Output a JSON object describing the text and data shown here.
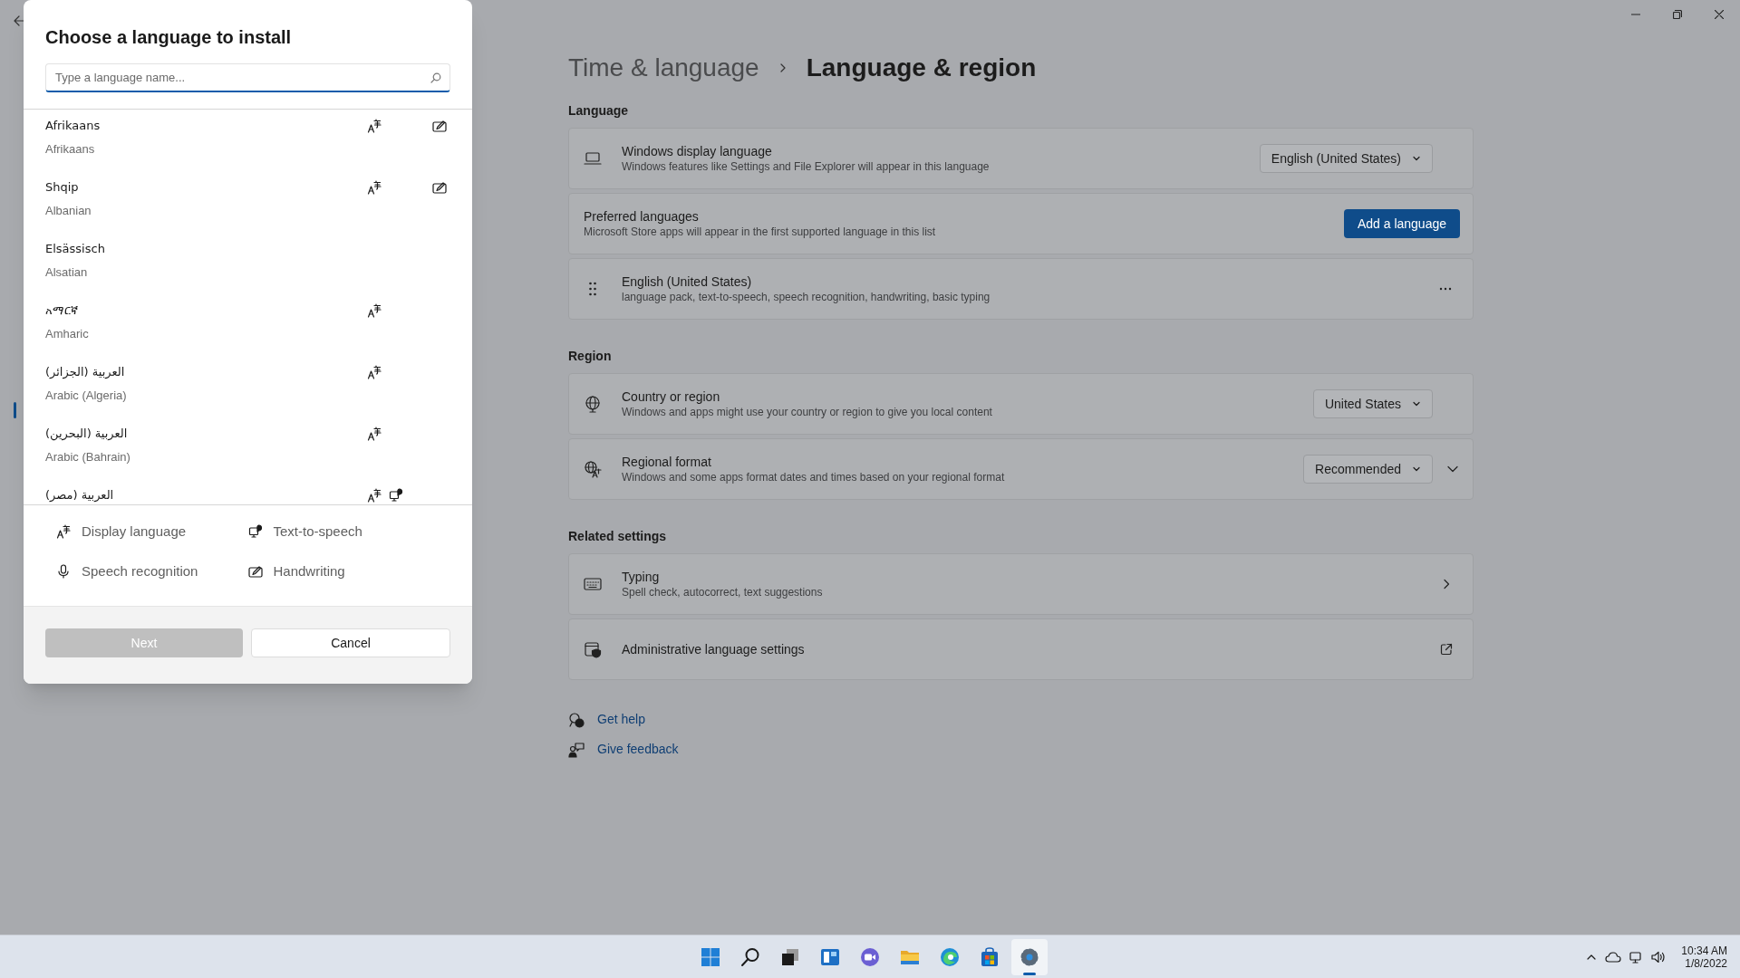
{
  "window": {
    "breadcrumb": [
      "Time & language",
      "Language & region"
    ]
  },
  "sections": [
    {
      "heading": "Language",
      "cards": [
        {
          "kind": "dropdown",
          "title": "Windows display language",
          "subtitle": "Windows features like Settings and File Explorer will appear in this language",
          "value": "English (United States)"
        },
        {
          "kind": "button",
          "title": "Preferred languages",
          "subtitle": "Microsoft Store apps will appear in the first supported language in this list",
          "button": "Add a language"
        },
        {
          "kind": "more",
          "title": "English (United States)",
          "subtitle": "language pack, text-to-speech, speech recognition, handwriting, basic typing"
        }
      ]
    },
    {
      "heading": "Region",
      "cards": [
        {
          "kind": "dropdown",
          "title": "Country or region",
          "subtitle": "Windows and apps might use your country or region to give you local content",
          "value": "United States"
        },
        {
          "kind": "dropdown_expand",
          "title": "Regional format",
          "subtitle": "Windows and some apps format dates and times based on your regional format",
          "value": "Recommended",
          "expanded": false
        }
      ]
    },
    {
      "heading": "Related settings",
      "cards": [
        {
          "kind": "link",
          "title": "Typing",
          "subtitle": "Spell check, autocorrect, text suggestions"
        },
        {
          "kind": "external",
          "title": "Administrative language settings"
        }
      ]
    }
  ],
  "links": [
    "Get help",
    "Give feedback"
  ],
  "dialog": {
    "title": "Choose a language to install",
    "search": {
      "placeholder": "Type a language name..."
    },
    "languages": [
      {
        "native": "Afrikaans",
        "english": "Afrikaans",
        "display_language": true,
        "text_to_speech": false,
        "speech_recognition": false,
        "handwriting": true
      },
      {
        "native": "Shqip",
        "english": "Albanian",
        "display_language": true,
        "text_to_speech": false,
        "speech_recognition": false,
        "handwriting": true
      },
      {
        "native": "Elsässisch",
        "english": "Alsatian",
        "display_language": false,
        "text_to_speech": false,
        "speech_recognition": false,
        "handwriting": false
      },
      {
        "native": "አማርኛ",
        "english": "Amharic",
        "display_language": true,
        "text_to_speech": false,
        "speech_recognition": false,
        "handwriting": false
      },
      {
        "native": "العربية (الجزائر)",
        "english": "Arabic (Algeria)",
        "display_language": true,
        "text_to_speech": false,
        "speech_recognition": false,
        "handwriting": false
      },
      {
        "native": "العربية (البحرين)",
        "english": "Arabic (Bahrain)",
        "display_language": true,
        "text_to_speech": false,
        "speech_recognition": false,
        "handwriting": false
      },
      {
        "native": "العربية (مصر)",
        "display_language": true,
        "text_to_speech": true,
        "speech_recognition": false,
        "handwriting": false
      }
    ],
    "legend": [
      {
        "kind": "display_language",
        "label": "Display language"
      },
      {
        "kind": "text_to_speech",
        "label": "Text-to-speech"
      },
      {
        "kind": "speech_recognition",
        "label": "Speech recognition"
      },
      {
        "kind": "handwriting",
        "label": "Handwriting"
      }
    ],
    "buttons": [
      {
        "label": "Next",
        "disabled": true
      },
      {
        "label": "Cancel",
        "disabled": false
      }
    ]
  },
  "taskbar": {
    "apps": [
      {
        "selected": false
      },
      {
        "selected": false
      },
      {
        "selected": false
      },
      {
        "selected": false
      },
      {
        "selected": false
      },
      {
        "selected": false
      },
      {
        "selected": false
      },
      {
        "selected": false
      },
      {
        "selected": true
      }
    ],
    "time": "10:34 AM",
    "date": "1/8/2022"
  }
}
